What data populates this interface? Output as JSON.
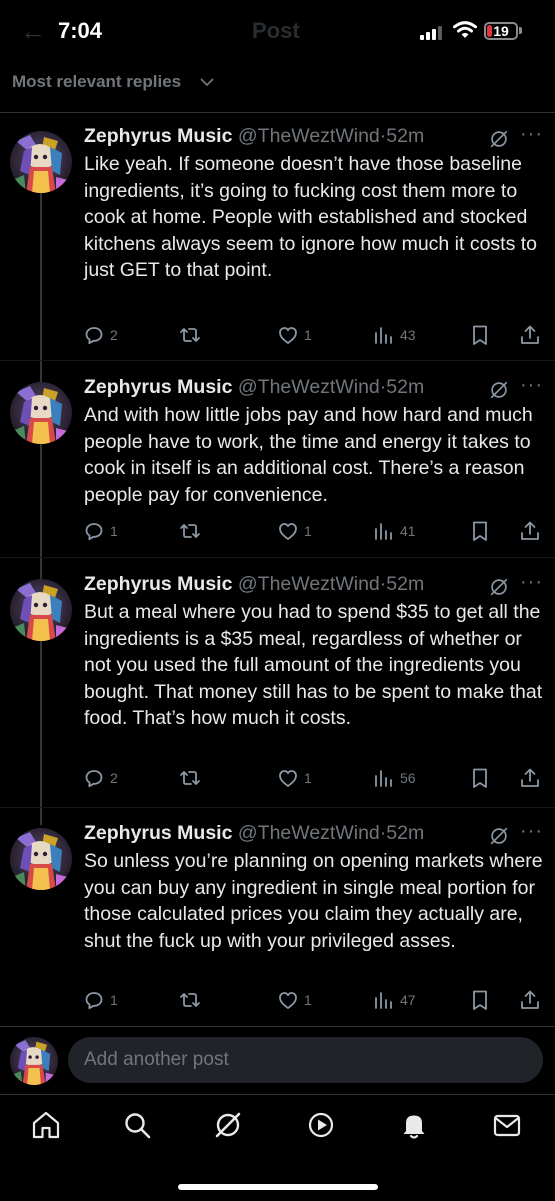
{
  "status_bar": {
    "time": "7:04",
    "battery": "19",
    "battery_level": 0.19
  },
  "header": {
    "title": "Post"
  },
  "sort": {
    "label": "Most relevant replies"
  },
  "posts": [
    {
      "name": "Zephyrus Music",
      "handle": "@TheWeztWind",
      "dot": "·",
      "time": "52m",
      "text": "Like yeah. If someone doesn’t have those baseline ingredients, it’s going to fucking cost them more to cook at home. People with established and stocked kitchens always seem to ignore how much it costs to just GET to that point.",
      "replies": "2",
      "reposts": "",
      "likes": "1",
      "views": "43"
    },
    {
      "name": "Zephyrus Music",
      "handle": "@TheWeztWind",
      "dot": "·",
      "time": "52m",
      "text": "And with how little jobs pay and how hard and much people have to work, the time and energy it takes to cook in itself is an additional cost. There’s a reason people pay for convenience.",
      "replies": "1",
      "reposts": "",
      "likes": "1",
      "views": "41"
    },
    {
      "name": "Zephyrus Music",
      "handle": "@TheWeztWind",
      "dot": "·",
      "time": "52m",
      "text": "But a meal where you had to spend $35 to get all the ingredients is a $35 meal, regardless of whether or not you used the full amount of the ingredients you bought. That money still has to be spent to make that food. That’s how much it costs.",
      "replies": "2",
      "reposts": "",
      "likes": "1",
      "views": "56"
    },
    {
      "name": "Zephyrus Music",
      "handle": "@TheWeztWind",
      "dot": "·",
      "time": "52m",
      "text": "So unless you’re planning on opening markets where you can buy any ingredient in single meal portion for those calculated prices you claim they actually are, shut the fuck up with your privileged asses.",
      "replies": "1",
      "reposts": "",
      "likes": "1",
      "views": "47"
    }
  ],
  "reply": {
    "placeholder": "Add another post"
  },
  "tabs": [
    "home-icon",
    "search-icon",
    "grok-icon",
    "video-icon",
    "notifications-icon",
    "messages-icon"
  ]
}
